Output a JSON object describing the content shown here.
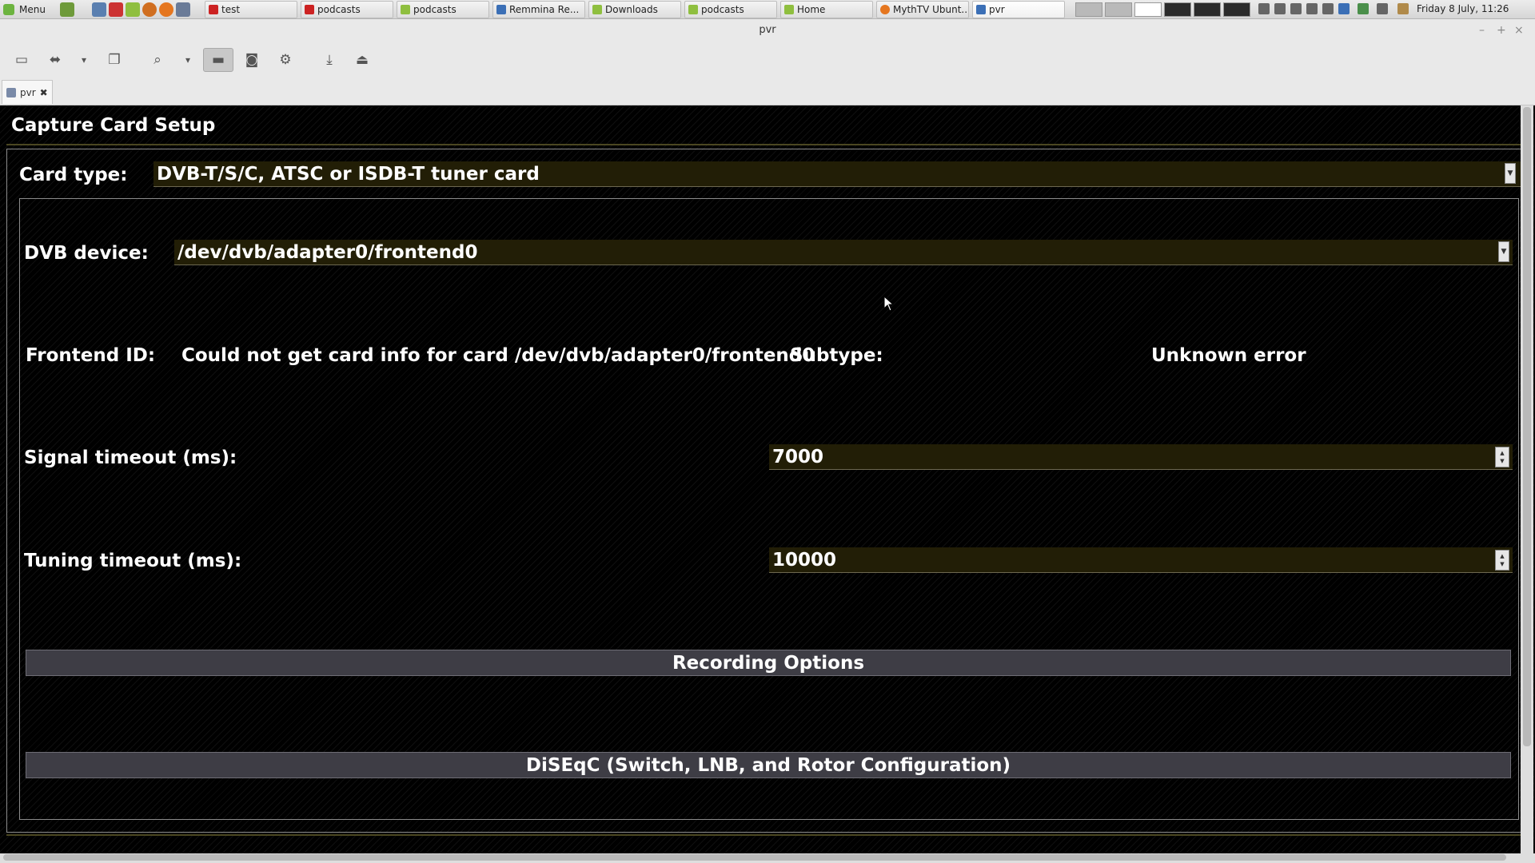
{
  "taskbar": {
    "menu_label": "Menu",
    "tasks": [
      {
        "label": "test",
        "color": "#cc2222"
      },
      {
        "label": "podcasts",
        "color": "#cc2222"
      },
      {
        "label": "podcasts",
        "color": "#8fbf3f"
      },
      {
        "label": "Remmina Re...",
        "color": "#3b6fb6"
      },
      {
        "label": "Downloads",
        "color": "#8fbf3f"
      },
      {
        "label": "podcasts",
        "color": "#8fbf3f"
      },
      {
        "label": "Home",
        "color": "#8fbf3f"
      },
      {
        "label": "MythTV Ubunt...",
        "color": "#e5761f"
      },
      {
        "label": "pvr",
        "color": "#3b6fb6"
      }
    ],
    "clock": "Friday  8 July, 11:26"
  },
  "window": {
    "title": "pvr",
    "tab_label": "pvr"
  },
  "page": {
    "title": "Capture Card Setup"
  },
  "card_type": {
    "label": "Card type:",
    "value": "DVB-T/S/C, ATSC or ISDB-T tuner card"
  },
  "dvb_device": {
    "label": "DVB device:",
    "value": "/dev/dvb/adapter0/frontend0"
  },
  "frontend": {
    "label": "Frontend ID:",
    "value": "Could not get card info for card /dev/dvb/adapter0/frontend0",
    "subtype_label": "Subtype:",
    "subtype_value": "Unknown error"
  },
  "signal_timeout": {
    "label": "Signal timeout (ms):",
    "value": "7000"
  },
  "tuning_timeout": {
    "label": "Tuning timeout (ms):",
    "value": "10000"
  },
  "sections": {
    "recording": "Recording Options",
    "diseqc": "DiSEqC (Switch, LNB, and Rotor Configuration)"
  },
  "icons": {
    "toolbar": [
      "fullscreen-icon",
      "scale-icon",
      "chevron-down-icon",
      "windows-icon",
      "zoom-icon",
      "chevron-down-icon",
      "keyboard-grab-icon",
      "screenshot-icon",
      "settings-icon",
      "download-icon",
      "disconnect-icon"
    ]
  }
}
